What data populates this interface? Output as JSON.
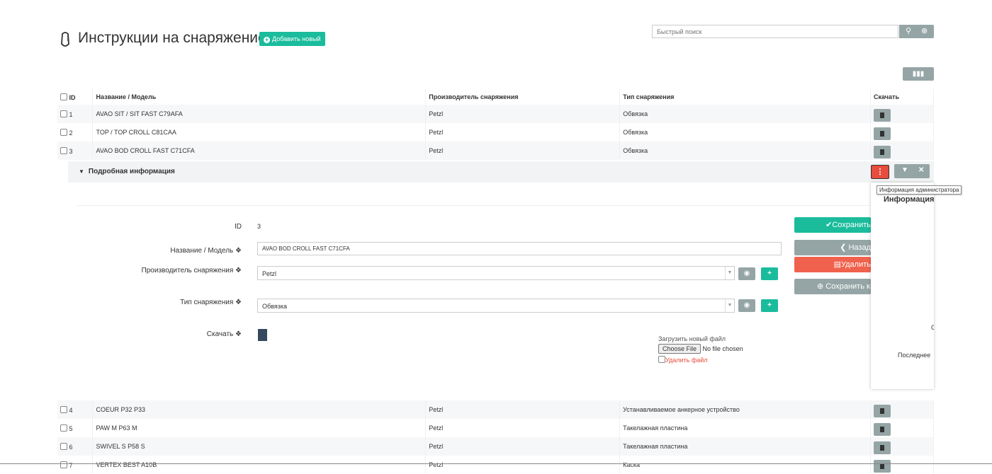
{
  "header": {
    "title": "Инструкции на снаряжение",
    "add_button": "Добавить новый",
    "search_placeholder": "Быстрый поиск"
  },
  "table": {
    "columns": [
      "ID",
      "Название / Модель",
      "Производитель снаряжения",
      "Тип снаряжения",
      "Скачать"
    ],
    "rows_top": [
      {
        "id": "1",
        "name": "AVAO SIT / SIT FAST C79AFA",
        "maker": "Petzl",
        "type": "Обвязка"
      },
      {
        "id": "2",
        "name": "TOP / TOP CROLL C81CAA",
        "maker": "Petzl",
        "type": "Обвязка"
      },
      {
        "id": "3",
        "name": "AVAO BOD CROLL FAST C71CFA",
        "maker": "Petzl",
        "type": "Обвязка"
      }
    ],
    "rows_bottom": [
      {
        "id": "4",
        "name": "COEUR P32 P33",
        "maker": "Petzl",
        "type": "Устанавливаемое анкерное устройство"
      },
      {
        "id": "5",
        "name": "PAW M P63 M",
        "maker": "Petzl",
        "type": "Такелажная пластина"
      },
      {
        "id": "6",
        "name": "SWIVEL S P58 S",
        "maker": "Petzl",
        "type": "Такелажная пластина"
      },
      {
        "id": "7",
        "name": "VERTEX BEST A10B",
        "maker": "Petzl",
        "type": "Каска"
      }
    ]
  },
  "detail": {
    "header": "Подробная информация",
    "id_label": "ID",
    "id_value": "3",
    "name_label": "Название / Модель",
    "name_value": "AVAO BOD CROLL FAST C71CFA",
    "maker_label": "Производитель снаряжения",
    "maker_value": "Petzl",
    "type_label": "Тип снаряжения",
    "type_value": "Обвязка",
    "download_label": "Скачать",
    "upload_label": "Загрузить новый файл",
    "choose_file": "Choose File",
    "no_file": "No file chosen",
    "delete_file": "Удалить файл",
    "save_button": "Сохранить",
    "back_button": "Назад",
    "delete_button": "Удалить",
    "save_copy_button": "Сохранить как"
  },
  "admin": {
    "tooltip": "Информация администратора",
    "panel_title": "Информация",
    "panel_c": "С",
    "panel_last": "Последнее"
  },
  "colors": {
    "teal": "#1abc9c",
    "gray": "#95a5a6",
    "red": "#e74c3c",
    "coral": "#f0624d"
  }
}
